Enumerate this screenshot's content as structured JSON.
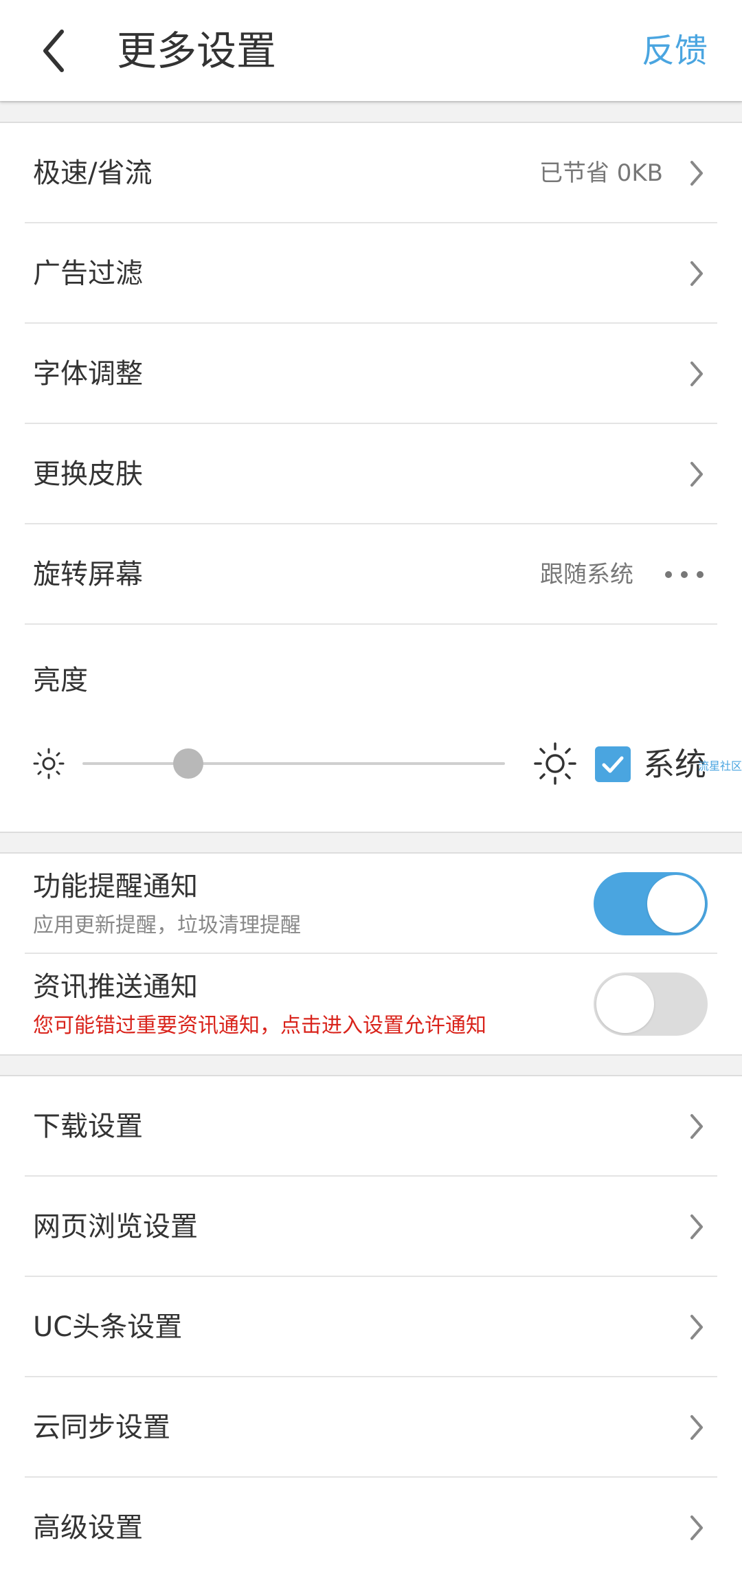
{
  "header": {
    "title": "更多设置",
    "feedback_label": "反馈",
    "back_icon": "chevron-left-icon"
  },
  "group1": [
    {
      "label": "极速/省流",
      "value": "已节省 0KB",
      "trail": "chevron-right-icon"
    },
    {
      "label": "广告过滤",
      "value": "",
      "trail": "chevron-right-icon"
    },
    {
      "label": "字体调整",
      "value": "",
      "trail": "chevron-right-icon"
    },
    {
      "label": "更换皮肤",
      "value": "",
      "trail": "chevron-right-icon"
    },
    {
      "label": "旋转屏幕",
      "value": "跟随系统",
      "trail": "more-dots-icon"
    }
  ],
  "brightness": {
    "label": "亮度",
    "level": 0.25,
    "system_label": "系统",
    "system_checked": true,
    "watermark": "流星社区"
  },
  "notifications": [
    {
      "title": "功能提醒通知",
      "subtitle": "应用更新提醒，垃圾清理提醒",
      "enabled": true,
      "subtitle_color": "#888888"
    },
    {
      "title": "资讯推送通知",
      "subtitle": "您可能错过重要资讯通知，点击进入设置允许通知",
      "enabled": false,
      "subtitle_color": "#d9231b"
    }
  ],
  "group2": [
    {
      "label": "下载设置"
    },
    {
      "label": "网页浏览设置"
    },
    {
      "label": "UC头条设置"
    },
    {
      "label": "云同步设置"
    },
    {
      "label": "高级设置"
    }
  ],
  "colors": {
    "accent": "#4aa5e0",
    "warning": "#d9231b",
    "background": "#ffffff",
    "section_gap": "#f2f2f2"
  }
}
